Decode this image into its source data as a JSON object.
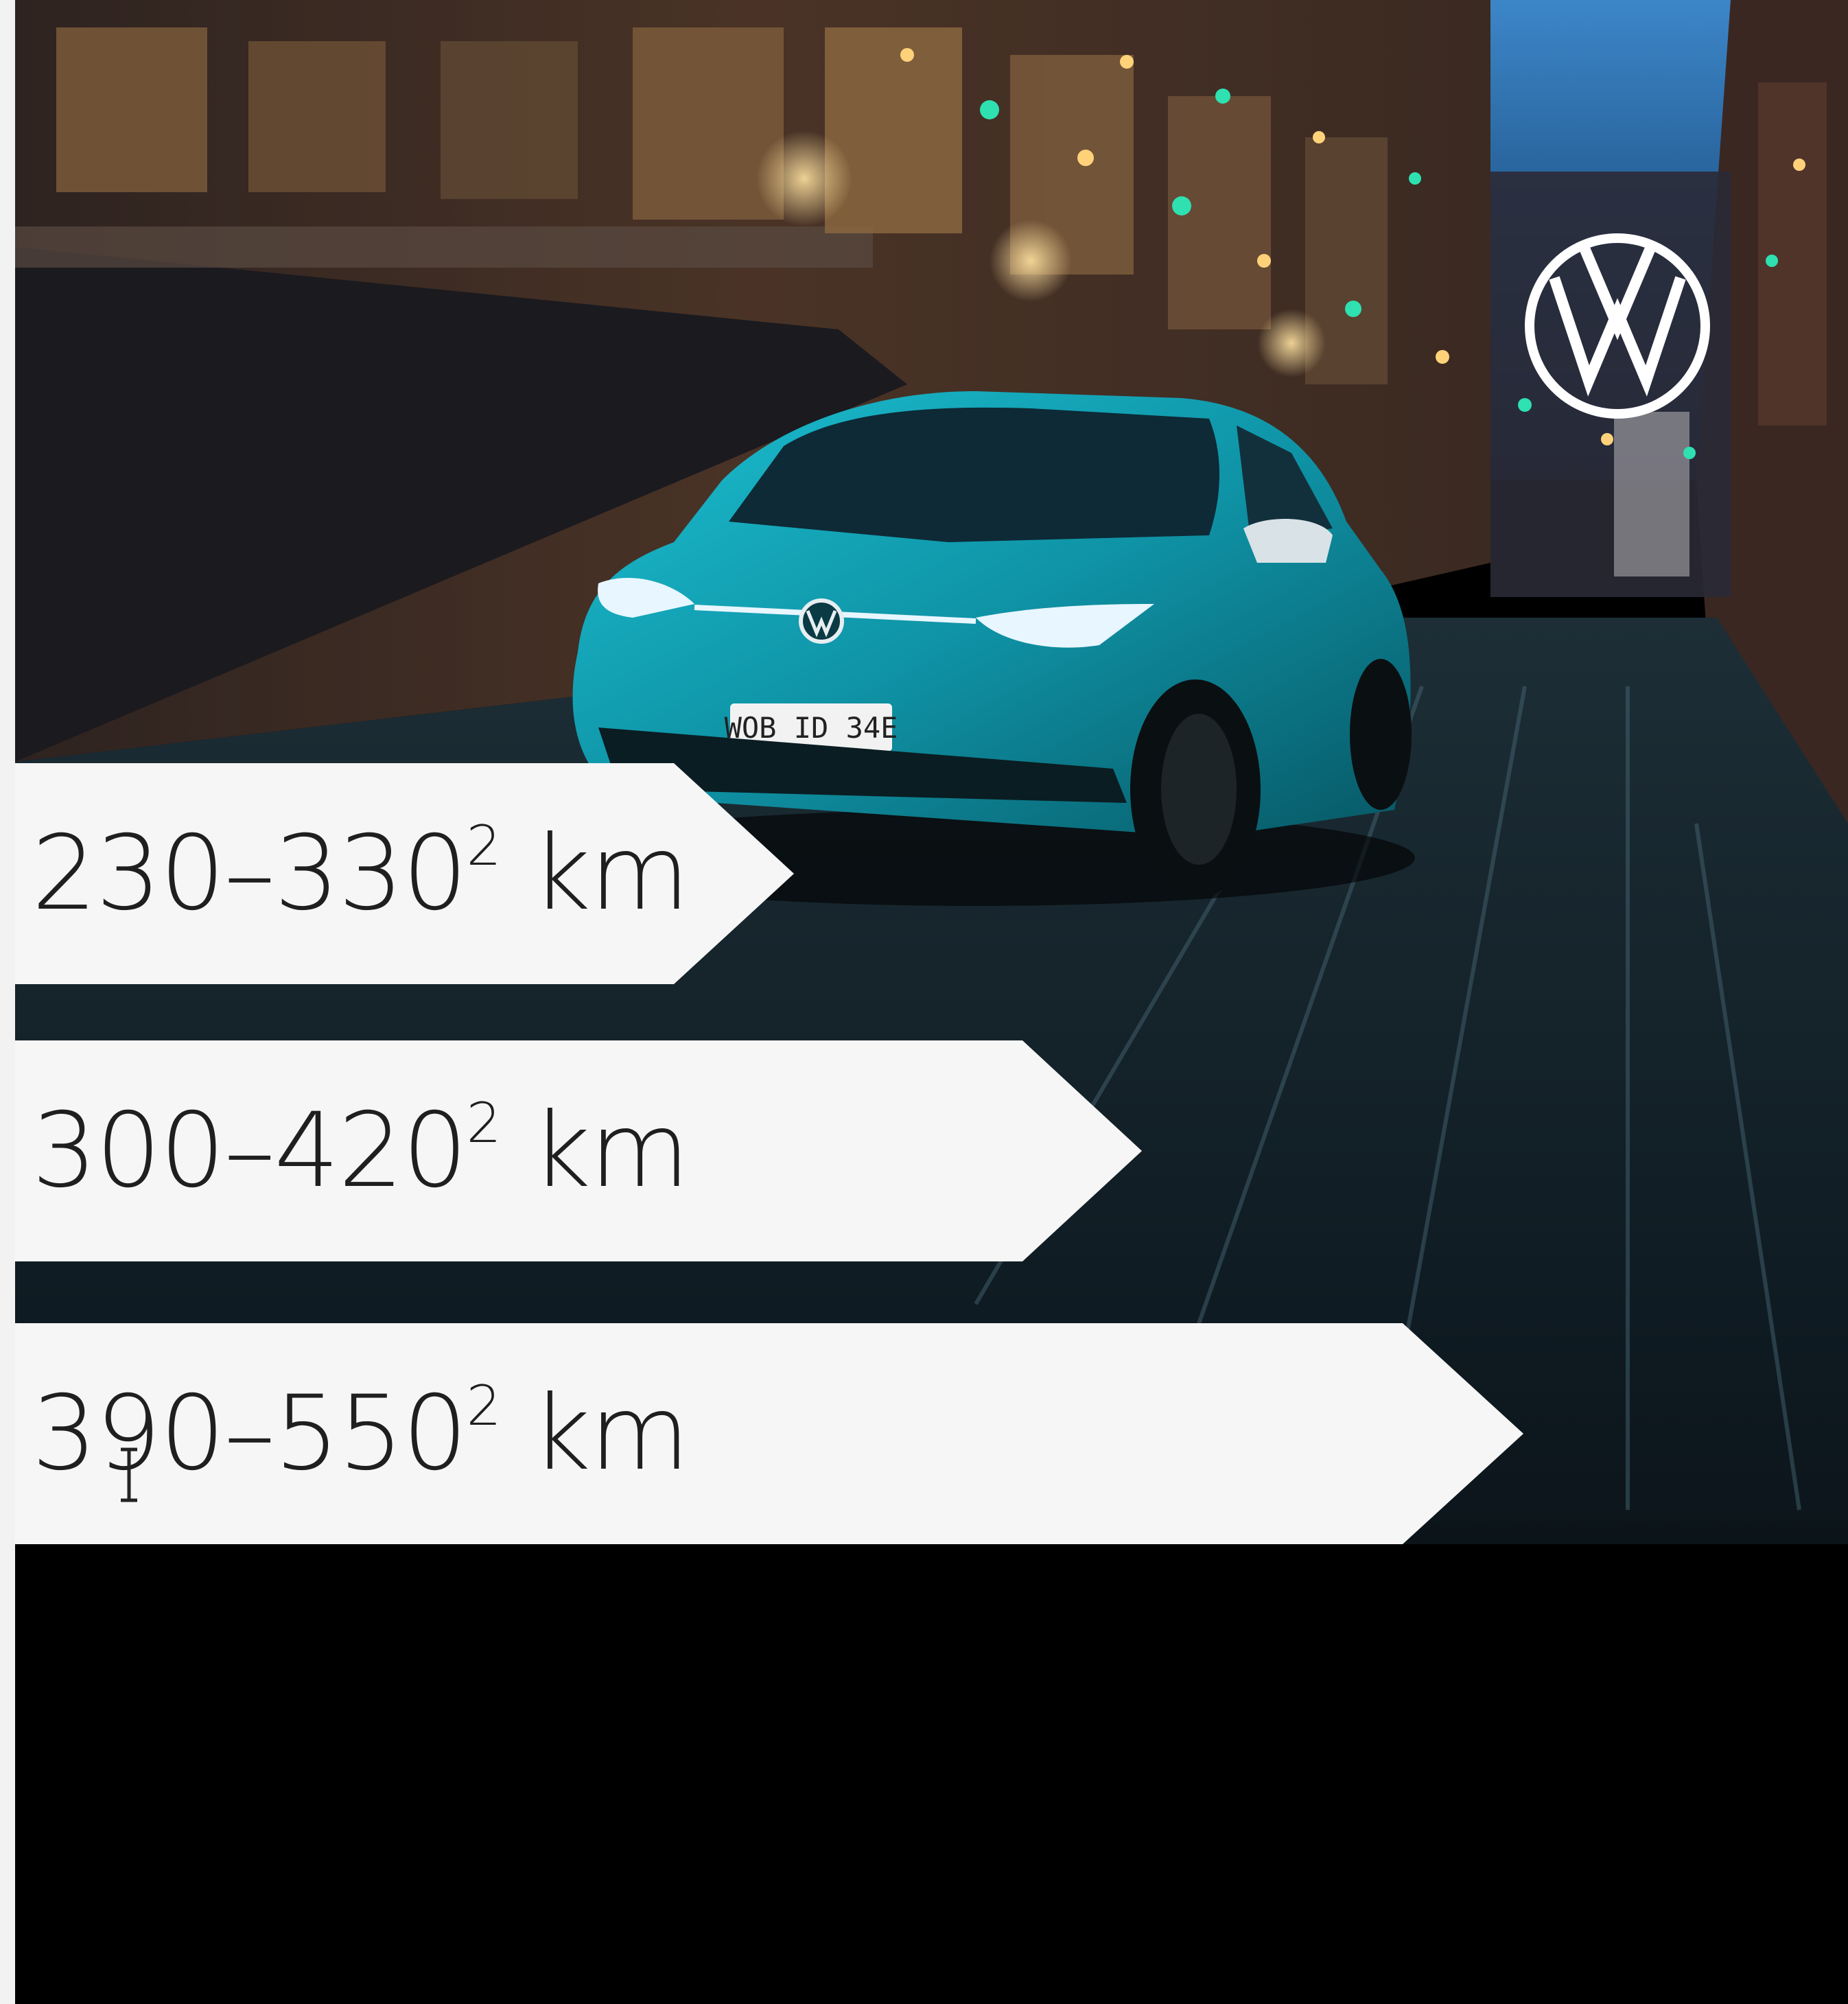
{
  "brand": {
    "logo_icon": "vw-logo-icon",
    "logo_color": "#ffffff"
  },
  "car": {
    "plate": "WOB ID 34E",
    "body_color": "#14a3b4"
  },
  "ranges": [
    {
      "value": "230–330",
      "superscript": "2",
      "unit": "km"
    },
    {
      "value": "300–420",
      "superscript": "2",
      "unit": "km"
    },
    {
      "value": "390–550",
      "superscript": "2",
      "unit": "km"
    }
  ],
  "colors": {
    "arrow_fill": "#f6f6f6",
    "text": "#1f1f1f",
    "background": "#000000"
  }
}
